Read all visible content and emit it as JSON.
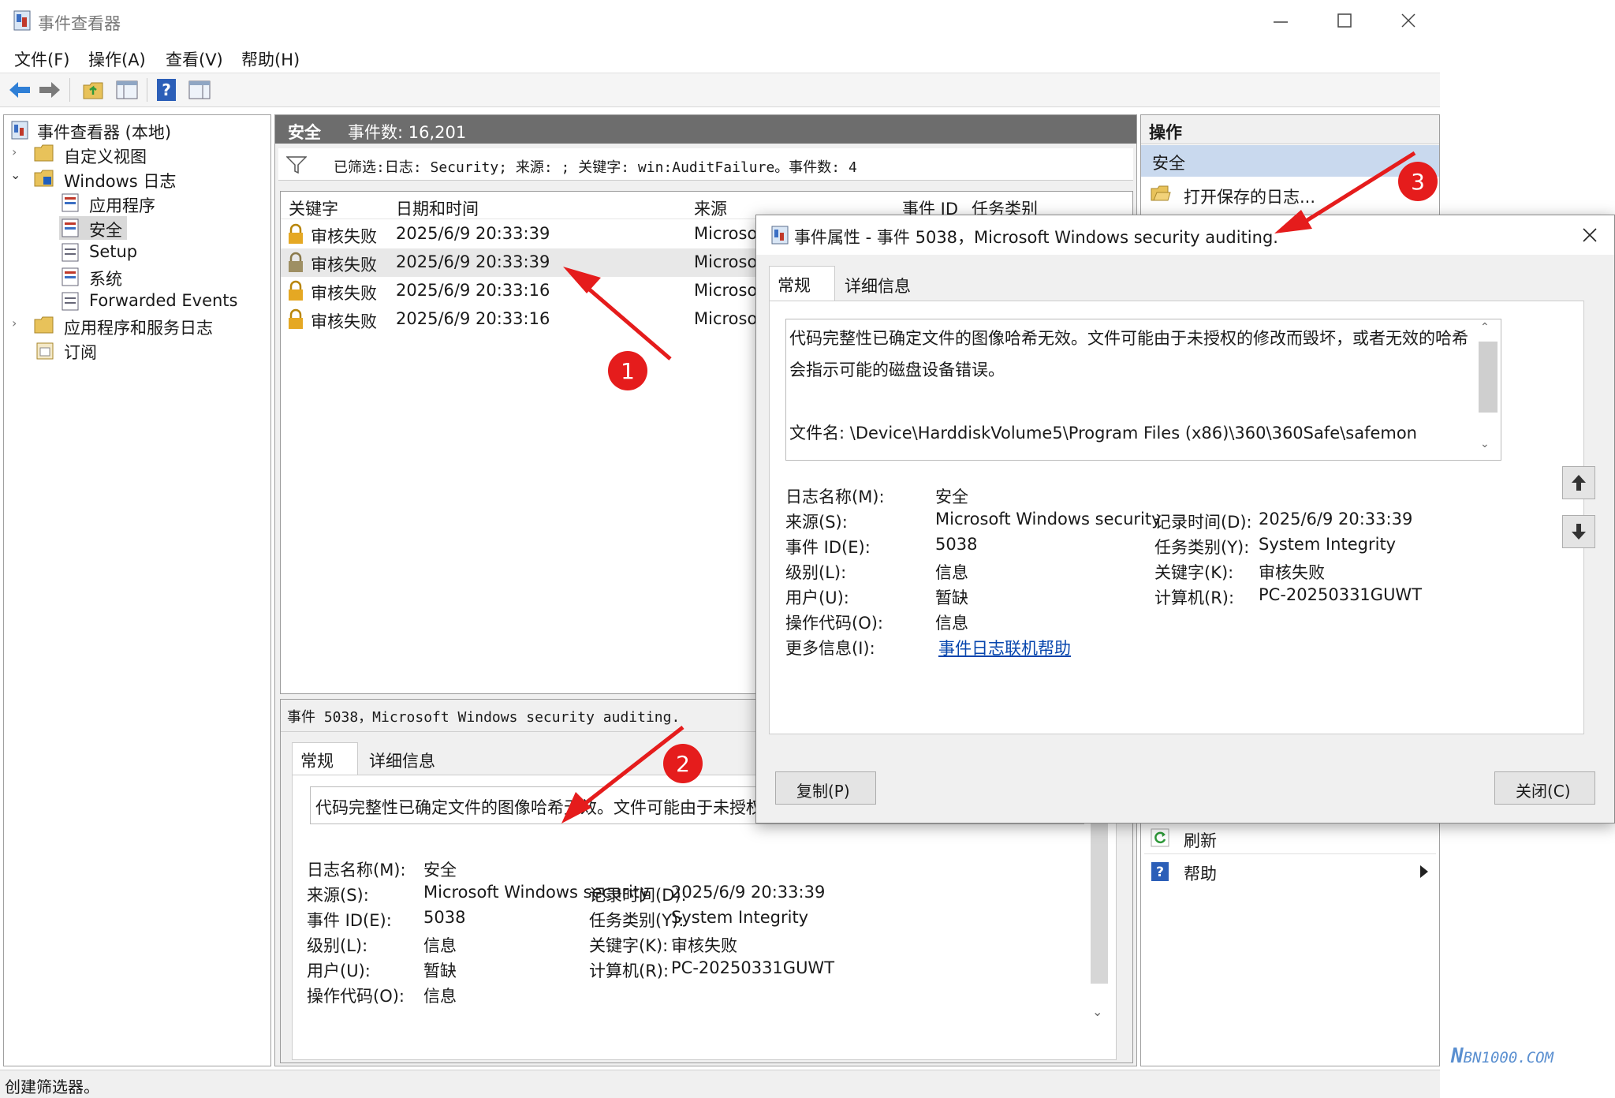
{
  "window": {
    "title": "事件查看器",
    "controls": [
      "minimize-icon",
      "maximize-icon",
      "close-icon"
    ]
  },
  "menu": [
    "文件(F)",
    "操作(A)",
    "查看(V)",
    "帮助(H)"
  ],
  "toolbar": [
    "back-arrow-icon",
    "forward-arrow-icon",
    "folder-up-icon",
    "show-hide-tree-icon",
    "help-icon",
    "action-pane-icon"
  ],
  "tree": {
    "root": "事件查看器 (本地)",
    "custom_views": "自定义视图",
    "windows_logs": "Windows 日志",
    "logs": [
      "应用程序",
      "安全",
      "Setup",
      "系统",
      "Forwarded Events"
    ],
    "app_service_logs": "应用程序和服务日志",
    "subscriptions": "订阅"
  },
  "center": {
    "log_name": "安全",
    "event_count": "事件数: 16,201",
    "filter_text": "已筛选:日志: Security; 来源: ; 关键字: win:AuditFailure。事件数: 4",
    "columns": [
      "关键字",
      "日期和时间",
      "来源",
      "事件 ID",
      "任务类别"
    ],
    "rows": [
      {
        "keyword": "审核失败",
        "datetime": "2025/6/9 20:33:39",
        "source": "Microsof"
      },
      {
        "keyword": "审核失败",
        "datetime": "2025/6/9 20:33:39",
        "source": "Microsof"
      },
      {
        "keyword": "审核失败",
        "datetime": "2025/6/9 20:33:16",
        "source": "Microsof"
      },
      {
        "keyword": "审核失败",
        "datetime": "2025/6/9 20:33:16",
        "source": "Microsof"
      }
    ],
    "preview_title": "事件 5038，Microsoft Windows security auditing.",
    "tabs": [
      "常规",
      "详细信息"
    ],
    "preview_desc": "代码完整性已确定文件的图像哈希无效。文件可能由于未授权",
    "fields": {
      "log_label": "日志名称(M):",
      "log_value": "安全",
      "source_label": "来源(S):",
      "source_value": "Microsoft Windows security",
      "logged_label": "记录时间(D):",
      "logged_value": "2025/6/9 20:33:39",
      "eventid_label": "事件 ID(E):",
      "eventid_value": "5038",
      "task_label": "任务类别(Y):",
      "task_value": "System Integrity",
      "level_label": "级别(L):",
      "level_value": "信息",
      "keyword_label": "关键字(K):",
      "keyword_value": "审核失败",
      "user_label": "用户(U):",
      "user_value": "暂缺",
      "computer_label": "计算机(R):",
      "computer_value": "PC-20250331GUWT",
      "opcode_label": "操作代码(O):",
      "opcode_value": "信息"
    }
  },
  "actions": {
    "header": "操作",
    "section": "安全",
    "open_saved": "打开保存的日志...",
    "refresh": "刷新",
    "help": "帮助"
  },
  "dialog": {
    "title": "事件属性 - 事件 5038，Microsoft Windows security auditing.",
    "tabs": [
      "常规",
      "详细信息"
    ],
    "desc_line1": "代码完整性已确定文件的图像哈希无效。文件可能由于未授权的修改而毁坏，或者无效的哈希",
    "desc_line2": "会指示可能的磁盘设备错误。",
    "desc_line3": "文件名:  \\Device\\HarddiskVolume5\\Program Files (x86)\\360\\360Safe\\safemon",
    "more_info_label": "更多信息(I):",
    "more_info_link": "事件日志联机帮助",
    "copy_button": "复制(P)",
    "close_button": "关闭(C)"
  },
  "annotations": [
    "1",
    "2",
    "3"
  ],
  "status": "创建筛选器。",
  "watermark": "BN1000.COM",
  "colors": {
    "annotation_red": "#e51c1c",
    "dark_header": "#6d6d6d",
    "selection_blue": "#cce4f7",
    "link_blue": "#0645ad"
  }
}
